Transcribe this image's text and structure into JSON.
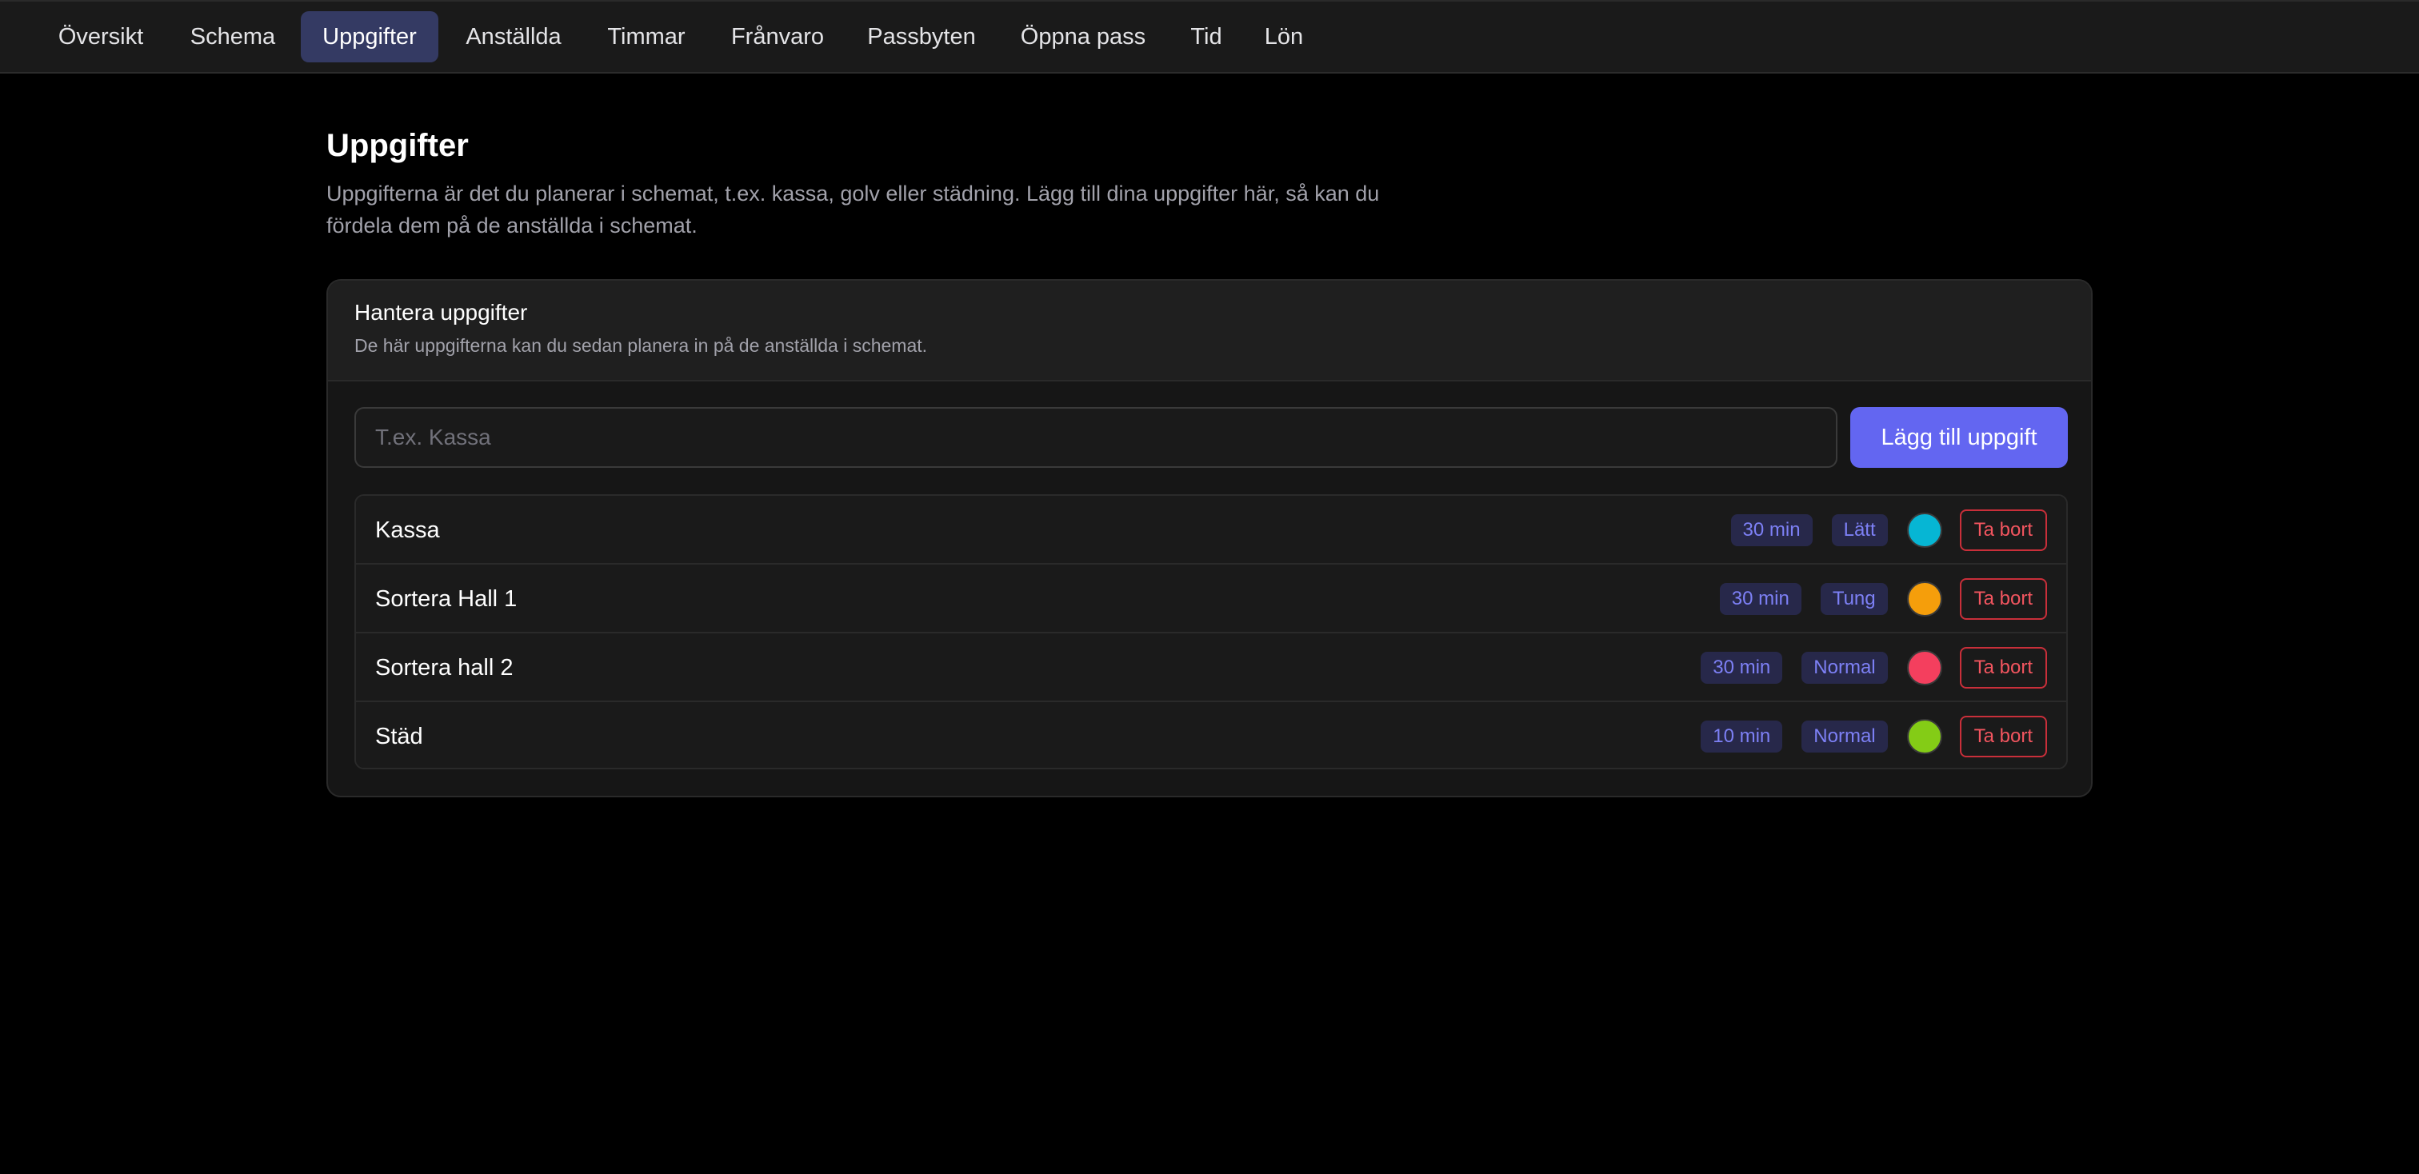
{
  "nav": {
    "items": [
      {
        "label": "Översikt",
        "active": false
      },
      {
        "label": "Schema",
        "active": false
      },
      {
        "label": "Uppgifter",
        "active": true
      },
      {
        "label": "Anställda",
        "active": false
      },
      {
        "label": "Timmar",
        "active": false
      },
      {
        "label": "Frånvaro",
        "active": false
      },
      {
        "label": "Passbyten",
        "active": false
      },
      {
        "label": "Öppna pass",
        "active": false
      },
      {
        "label": "Tid",
        "active": false
      },
      {
        "label": "Lön",
        "active": false
      }
    ]
  },
  "page": {
    "title": "Uppgifter",
    "description": "Uppgifterna är det du planerar i schemat, t.ex. kassa, golv eller städning. Lägg till dina uppgifter här, så kan du fördela dem på de anställda i schemat."
  },
  "card": {
    "title": "Hantera uppgifter",
    "subtitle": "De här uppgifterna kan du sedan planera in på de anställda i schemat.",
    "input_placeholder": "T.ex. Kassa",
    "input_value": "",
    "add_button_label": "Lägg till uppgift",
    "tasks": [
      {
        "name": "Kassa",
        "duration": "30 min",
        "level": "Lätt",
        "color": "#06b6d4",
        "delete_label": "Ta bort"
      },
      {
        "name": "Sortera Hall 1",
        "duration": "30 min",
        "level": "Tung",
        "color": "#f59e0b",
        "delete_label": "Ta bort"
      },
      {
        "name": "Sortera hall 2",
        "duration": "30 min",
        "level": "Normal",
        "color": "#f43f5e",
        "delete_label": "Ta bort"
      },
      {
        "name": "Städ",
        "duration": "10 min",
        "level": "Normal",
        "color": "#84cc16",
        "delete_label": "Ta bort"
      }
    ]
  }
}
